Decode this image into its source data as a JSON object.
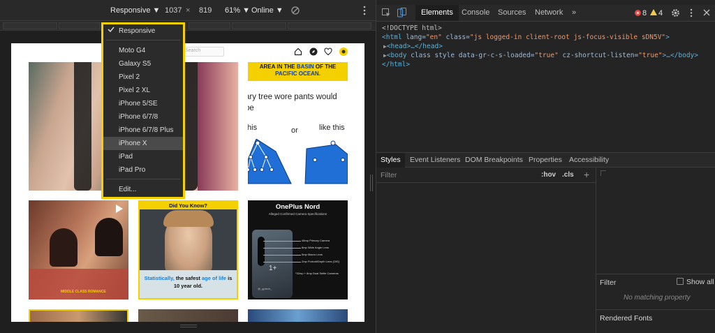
{
  "device_toolbar": {
    "device": "Responsive ▼",
    "width": "1037",
    "times": "×",
    "height": "819",
    "zoom": "61% ▼",
    "throttle": "Online ▼"
  },
  "device_menu": {
    "checked_label": "Responsive",
    "items": [
      "Moto G4",
      "Galaxy S5",
      "Pixel 2",
      "Pixel 2 XL",
      "iPhone 5/SE",
      "iPhone 6/7/8",
      "iPhone 6/7/8 Plus",
      "iPhone X",
      "iPad",
      "iPad Pro"
    ],
    "highlighted": "iPhone X",
    "edit_label": "Edit..."
  },
  "site": {
    "search_placeholder": "Search",
    "post1_banner": [
      "AREA IN THE ",
      "BASIN",
      " OF THE",
      "PACIFIC OCEAN."
    ],
    "post2_text_top": "ary tree wore pants would",
    "post2_text_mid": "be",
    "post2_left": "this",
    "post2_or": "or",
    "post2_right": "like this",
    "post4_header": "Did You Know?",
    "post4_caption_1": "Statistically,",
    "post4_caption_2": " the safest ",
    "post4_caption_3": "age of life",
    "post4_caption_4": " is",
    "post4_caption_5": "10 year old.",
    "post5_title": "OnePlus Nord",
    "post5_subtitle": "Alleged Confirmed Camera Specifications",
    "post5_specs": [
      "48mp Primary Camera",
      "8mp Wide Angle Lens",
      "5mp Macro Lens",
      "2mp Portrait/Depth Lens (OIS)"
    ],
    "post5_footer": "*32mp + 8mp Dual Selfie Cameras",
    "post5_handle": "@_gptech_",
    "post3_caption": "MIDDLE CLASS ROMANCE"
  },
  "devtools": {
    "tabs": [
      "Elements",
      "Console",
      "Sources",
      "Network",
      "»"
    ],
    "active_tab": "Elements",
    "errors": "8",
    "warnings": "4",
    "code": {
      "doctype": "<!DOCTYPE html>",
      "html_open_tag": "<html",
      "lang_attr": " lang=",
      "lang_val": "\"en\"",
      "class_attr": " class=",
      "class_val": "\"js logged-in client-root js-focus-visible sDN5V\"",
      "html_close": ">",
      "head": "<head>…</head>",
      "body_open": "<body",
      "body_attrs": " class style data-gr-c-s-loaded=",
      "body_val1": "\"true\"",
      "body_attr2": " cz-shortcut-listen=",
      "body_val2": "\"true\"",
      "body_end": ">…</body>",
      "html_end": "</html>"
    },
    "styles_tabs": [
      "Styles",
      "Event Listeners",
      "DOM Breakpoints",
      "Properties",
      "Accessibility"
    ],
    "filter_placeholder": "Filter",
    "hov": ":hov",
    "cls": ".cls",
    "plus": "+",
    "computed_filter": "Filter",
    "show_all": "Show all",
    "no_matching": "No matching property",
    "rendered_fonts": "Rendered Fonts"
  },
  "colors": {
    "highlight_border": "#f5d000",
    "devtools_bg": "#242424",
    "error": "#e0463b",
    "warning": "#f2c94c"
  }
}
